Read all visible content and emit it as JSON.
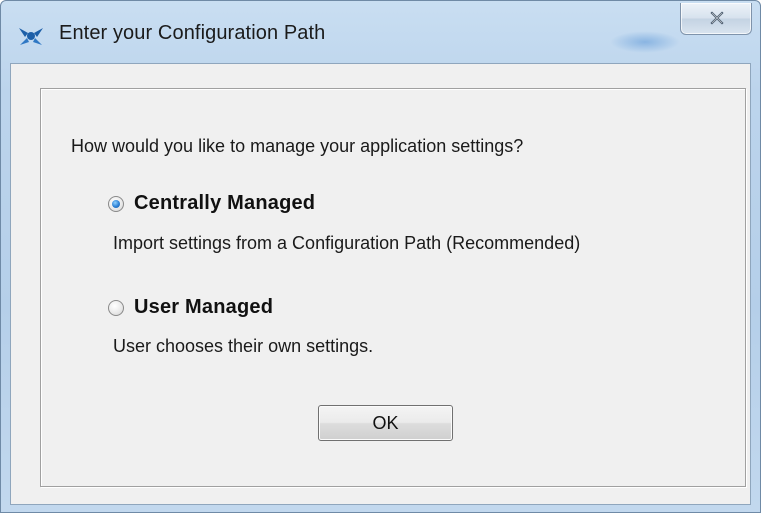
{
  "window": {
    "title": "Enter your Configuration Path",
    "close_icon": "close-icon",
    "app_icon": "app-logo-icon"
  },
  "dialog": {
    "question": "How would you like to manage your application settings?",
    "options": [
      {
        "label": "Centrally Managed",
        "description": "Import settings from a Configuration Path (Recommended)",
        "selected": true
      },
      {
        "label": "User Managed",
        "description": "User chooses their own settings.",
        "selected": false
      }
    ],
    "ok_label": "OK"
  },
  "colors": {
    "titlebar": "#bcd4ec",
    "client_bg": "#f0f0f0",
    "radio_selected": "#2b7fd4"
  }
}
